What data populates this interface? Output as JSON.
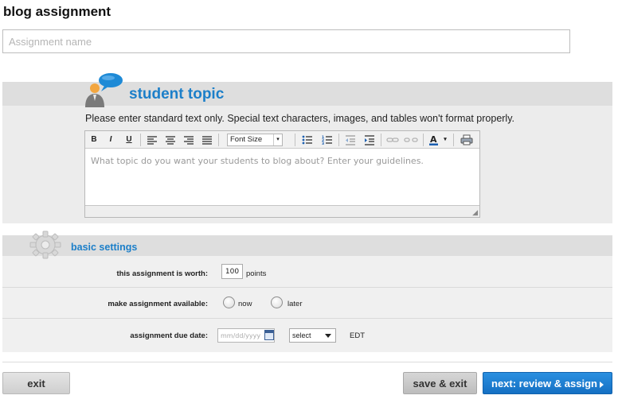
{
  "page": {
    "title": "blog assignment"
  },
  "assignment_name": {
    "placeholder": "Assignment name",
    "value": ""
  },
  "topic": {
    "title": "student topic",
    "note": "Please enter standard text only. Special text characters, images, and tables won't format properly.",
    "toolbar": {
      "bold": "B",
      "italic": "I",
      "underline": "U",
      "font_size": "Font Size",
      "icons": [
        "bold-icon",
        "italic-icon",
        "underline-icon",
        "align-left-icon",
        "align-center-icon",
        "align-right-icon",
        "align-justify-icon",
        "unordered-list-icon",
        "ordered-list-icon",
        "outdent-icon",
        "indent-icon",
        "link-icon",
        "unlink-icon",
        "text-color-icon",
        "print-icon"
      ]
    },
    "editor_placeholder": "What topic do you want your students to blog about? Enter your guidelines."
  },
  "settings": {
    "title": "basic settings",
    "worth_label": "this assignment is worth:",
    "points_value": "100",
    "points_unit": "points",
    "available_label": "make assignment available:",
    "available_options": [
      "now",
      "later"
    ],
    "due_label": "assignment due date:",
    "date_placeholder": "mm/dd/yyyy",
    "time_select": "select",
    "timezone": "EDT"
  },
  "footer": {
    "exit": "exit",
    "save_exit": "save & exit",
    "next": "next: review & assign"
  },
  "colors": {
    "accent": "#1c7fc9",
    "primary_button": "#1a7cd2",
    "panel_bg": "#ececec"
  }
}
